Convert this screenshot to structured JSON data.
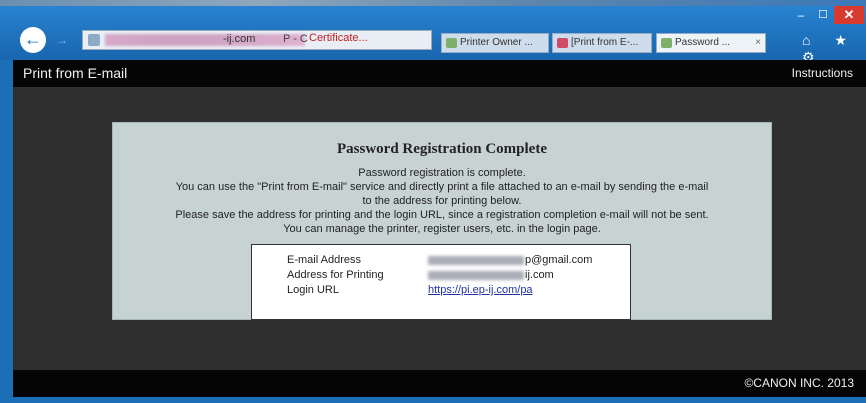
{
  "browser": {
    "address": {
      "suffix": "-ij.com",
      "tools": "P - C",
      "cert": "Certificate..."
    },
    "tabs": [
      {
        "label": "Printer Owner ..."
      },
      {
        "label": "[Print from E-..."
      },
      {
        "label": "Password ..."
      }
    ],
    "window": {
      "minimize": "‒",
      "maximize": "☐",
      "close": "✕"
    },
    "back": "←",
    "forward": "→",
    "nav_icons": "⌂ ★ ⚙"
  },
  "app": {
    "title": "Print from E-mail",
    "instructions": "Instructions"
  },
  "panel": {
    "title": "Password Registration Complete",
    "lines": [
      "Password registration is complete.",
      "You can use the \"Print from E-mail\" service and directly print a file attached to an e-mail by sending the e-mail",
      "to the address for printing below.",
      "Please save the address for printing and the login URL, since a registration completion e-mail will not be sent.",
      "You can manage the printer, register users, etc. in the login page."
    ],
    "info": [
      {
        "label": "E-mail Address",
        "value": "p@gmail.com"
      },
      {
        "label": "Address for Printing",
        "value": "ij.com"
      },
      {
        "label": "Login URL",
        "value": "https://pi.ep-ij.com/pa"
      }
    ]
  },
  "footer": {
    "copyright": "©CANON INC. 2013"
  },
  "colors": {
    "chrome": "#1b6fb6",
    "app_bar": "#050505",
    "content_bg": "#2f2f2f",
    "panel_bg": "#c7d3d3",
    "close": "#d93a30",
    "link": "#2233aa"
  }
}
